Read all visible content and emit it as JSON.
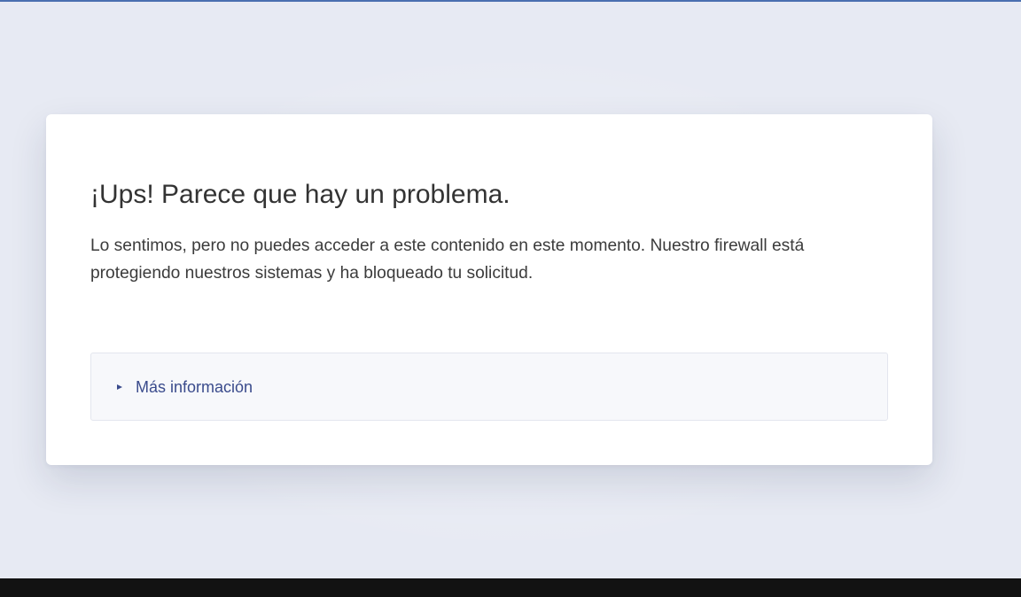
{
  "page": {
    "title": "¡Ups! Parece que hay un problema.",
    "message": "Lo sentimos, pero no puedes acceder a este contenido en este momento. Nuestro firewall está protegiendo nuestros sistemas y ha bloqueado tu solicitud.",
    "details": {
      "label": "Más información",
      "icon": "chevron-right-icon",
      "expanded": false
    }
  },
  "colors": {
    "background": "#e7eaf3",
    "card": "#ffffff",
    "link": "#3a4b8c",
    "top_accent": "#4a6fb0",
    "bottom_bar": "#121212"
  }
}
